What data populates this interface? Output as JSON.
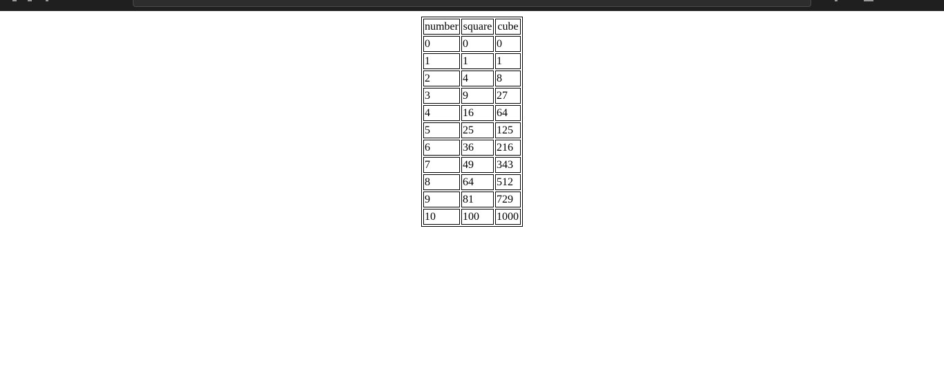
{
  "table": {
    "headers": [
      "number",
      "square",
      "cube"
    ],
    "rows": [
      [
        "0",
        "0",
        "0"
      ],
      [
        "1",
        "1",
        "1"
      ],
      [
        "2",
        "4",
        "8"
      ],
      [
        "3",
        "9",
        "27"
      ],
      [
        "4",
        "16",
        "64"
      ],
      [
        "5",
        "25",
        "125"
      ],
      [
        "6",
        "36",
        "216"
      ],
      [
        "7",
        "49",
        "343"
      ],
      [
        "8",
        "64",
        "512"
      ],
      [
        "9",
        "81",
        "729"
      ],
      [
        "10",
        "100",
        "1000"
      ]
    ]
  },
  "theme": {
    "toolbar_color": "#1f1f1f",
    "page_background": "#ffffff",
    "border_color": "#000000"
  }
}
